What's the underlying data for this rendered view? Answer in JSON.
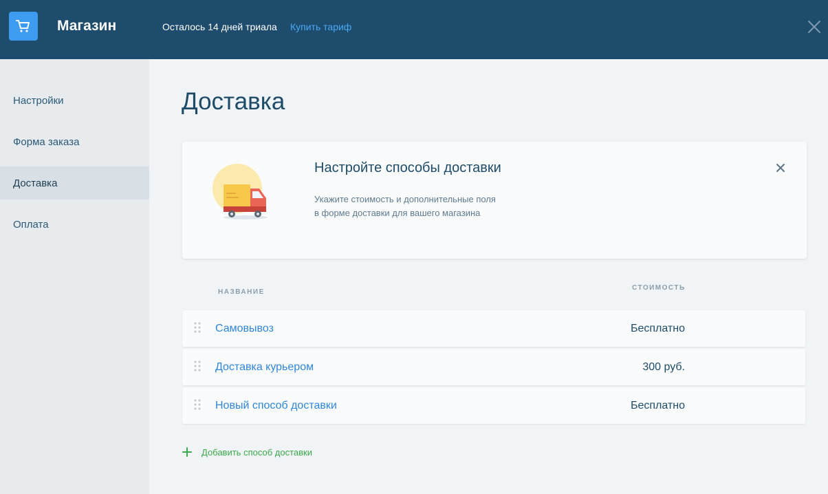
{
  "header": {
    "app_title": "Магазин",
    "trial_text": "Осталось 14 дней триала",
    "buy_link": "Купить тариф",
    "logo_icon": "cart-icon",
    "close_icon": "close-icon",
    "background_color": "#1d4c6c",
    "accent_color": "#3d9bf0"
  },
  "sidebar": {
    "items": [
      {
        "label": "Настройки",
        "active": false
      },
      {
        "label": "Форма заказа",
        "active": false
      },
      {
        "label": "Доставка",
        "active": true
      },
      {
        "label": "Оплата",
        "active": false
      }
    ]
  },
  "main": {
    "page_title": "Доставка",
    "promo": {
      "title": "Настройте способы доставки",
      "description_line1": "Укажите стоимость и дополнительные поля",
      "description_line2": "в форме доставки для вашего магазина",
      "illustration_icon": "delivery-truck-icon"
    },
    "table": {
      "col_name": "НАЗВАНИЕ",
      "col_cost": "СТОИМОСТЬ",
      "rows": [
        {
          "name": "Самовывоз",
          "price": "Бесплатно"
        },
        {
          "name": "Доставка курьером",
          "price": "300 руб."
        },
        {
          "name": "Новый способ доставки",
          "price": "Бесплатно"
        }
      ]
    },
    "add_method_label": "Добавить способ доставки",
    "link_color": "#2f86d8",
    "add_color": "#3aa84a"
  }
}
